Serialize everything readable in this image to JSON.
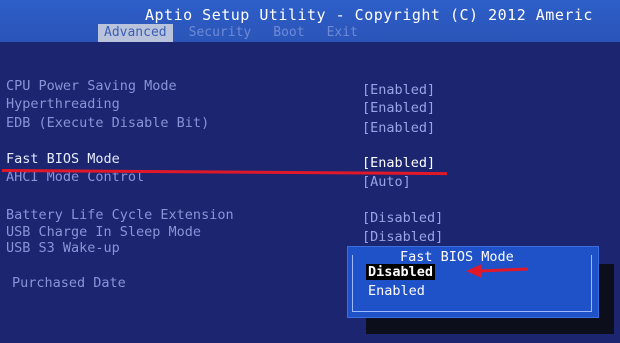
{
  "title": "Aptio Setup Utility - Copyright (C) 2012 Americ",
  "tabs": [
    {
      "label": "Advanced"
    },
    {
      "label": "Security"
    },
    {
      "label": "Boot"
    },
    {
      "label": "Exit"
    }
  ],
  "settings": [
    {
      "label": "CPU Power Saving Mode",
      "value": "[Enabled]"
    },
    {
      "label": "Hyperthreading",
      "value": "[Enabled]"
    },
    {
      "label": "EDB (Execute Disable Bit)",
      "value": "[Enabled]"
    },
    {
      "label": "Fast BIOS Mode",
      "value": "[Enabled]"
    },
    {
      "label": "AHCI Mode Control",
      "value": "[Auto]"
    },
    {
      "label": "Battery Life Cycle Extension",
      "value": "[Disabled]"
    },
    {
      "label": "USB Charge In Sleep Mode",
      "value": "[Disabled]"
    },
    {
      "label": "USB S3 Wake-up",
      "value": ""
    },
    {
      "label": "Purchased Date",
      "value": ""
    }
  ],
  "popup": {
    "title": "Fast BIOS Mode",
    "options": [
      "Disabled",
      "Enabled"
    ],
    "selected": "Disabled"
  },
  "colors": {
    "annotation": "#e0182a",
    "title_bar": "#2d5ec9",
    "panel": "#1b2570",
    "popup": "#1f51c8"
  }
}
